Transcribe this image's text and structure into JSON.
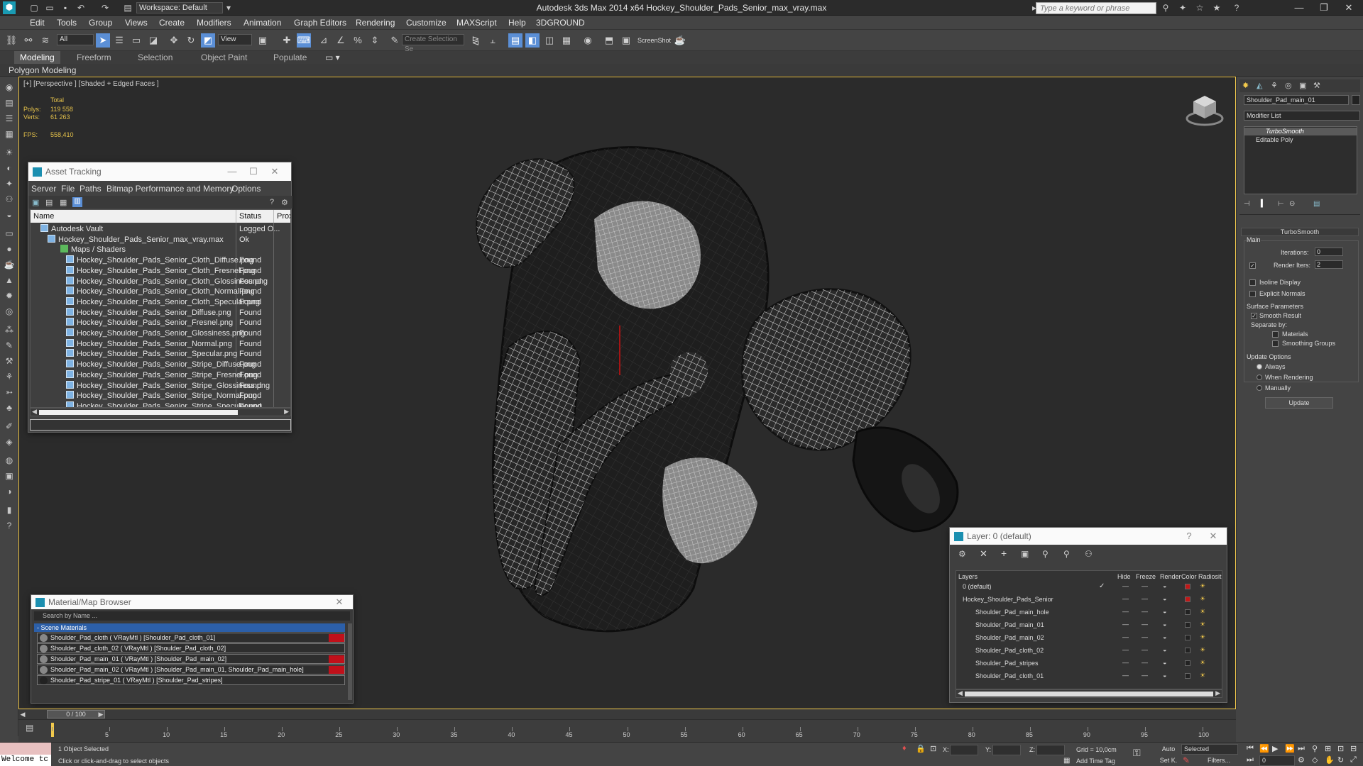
{
  "app": {
    "title": "Autodesk 3ds Max  2014 x64     Hockey_Shoulder_Pads_Senior_max_vray.max",
    "workspace": "Workspace: Default",
    "search_placeholder": "Type a keyword or phrase"
  },
  "menubar": [
    "Edit",
    "Tools",
    "Group",
    "Views",
    "Create",
    "Modifiers",
    "Animation",
    "Graph Editors",
    "Rendering",
    "Customize",
    "MAXScript",
    "Help",
    "3DGROUND"
  ],
  "toolbar": {
    "filter": "All",
    "ref_coord": "View",
    "selection_set": "Create Selection Se",
    "screenshot_label": "ScreenShot"
  },
  "ribbon": {
    "tabs": [
      "Modeling",
      "Freeform",
      "Selection",
      "Object Paint",
      "Populate"
    ],
    "sub_label": "Polygon Modeling"
  },
  "viewport": {
    "label": "[+] [Perspective ] [Shaded + Edged Faces ]",
    "stats": {
      "total_label": "Total",
      "polys_label": "Polys:",
      "polys": "119 558",
      "verts_label": "Verts:",
      "verts": "61 263",
      "fps_label": "FPS:",
      "fps": "558,410"
    }
  },
  "asset_tracking": {
    "title": "Asset Tracking",
    "menu": [
      "Server",
      "File",
      "Paths",
      "Bitmap Performance and Memory",
      "Options"
    ],
    "columns": [
      "Name",
      "Status",
      "Proxy"
    ],
    "rows": [
      {
        "name": "Autodesk Vault",
        "status": "Logged O..."
      },
      {
        "name": "Hockey_Shoulder_Pads_Senior_max_vray.max",
        "status": "Ok"
      },
      {
        "name": "Maps / Shaders",
        "status": ""
      },
      {
        "name": "Hockey_Shoulder_Pads_Senior_Cloth_Diffuse.png",
        "status": "Found"
      },
      {
        "name": "Hockey_Shoulder_Pads_Senior_Cloth_Fresnel.png",
        "status": "Found"
      },
      {
        "name": "Hockey_Shoulder_Pads_Senior_Cloth_Glossiness.png",
        "status": "Found"
      },
      {
        "name": "Hockey_Shoulder_Pads_Senior_Cloth_Normal.png",
        "status": "Found"
      },
      {
        "name": "Hockey_Shoulder_Pads_Senior_Cloth_Specular.png",
        "status": "Found"
      },
      {
        "name": "Hockey_Shoulder_Pads_Senior_Diffuse.png",
        "status": "Found"
      },
      {
        "name": "Hockey_Shoulder_Pads_Senior_Fresnel.png",
        "status": "Found"
      },
      {
        "name": "Hockey_Shoulder_Pads_Senior_Glossiness.png",
        "status": "Found"
      },
      {
        "name": "Hockey_Shoulder_Pads_Senior_Normal.png",
        "status": "Found"
      },
      {
        "name": "Hockey_Shoulder_Pads_Senior_Specular.png",
        "status": "Found"
      },
      {
        "name": "Hockey_Shoulder_Pads_Senior_Stripe_Diffuse.png",
        "status": "Found"
      },
      {
        "name": "Hockey_Shoulder_Pads_Senior_Stripe_Fresnel.png",
        "status": "Found"
      },
      {
        "name": "Hockey_Shoulder_Pads_Senior_Stripe_Glossiness.png",
        "status": "Found"
      },
      {
        "name": "Hockey_Shoulder_Pads_Senior_Stripe_Normal.png",
        "status": "Found"
      },
      {
        "name": "Hockey_Shoulder_Pads_Senior_Stripe_Specular.png",
        "status": "Found"
      }
    ]
  },
  "material_browser": {
    "title": "Material/Map Browser",
    "search_placeholder": "Search by Name ...",
    "group": "- Scene Materials",
    "items": [
      "Shoulder_Pad_cloth ( VRayMtl ) [Shoulder_Pad_cloth_01]",
      "Shoulder_Pad_cloth_02 ( VRayMtl ) [Shoulder_Pad_cloth_02]",
      "Shoulder_Pad_main_01 ( VRayMtl ) [Shoulder_Pad_main_02]",
      "Shoulder_Pad_main_02 ( VRayMtl ) [Shoulder_Pad_main_01, Shoulder_Pad_main_hole]",
      "Shoulder_Pad_stripe_01 ( VRayMtl ) [Shoulder_Pad_stripes]"
    ]
  },
  "layer_dialog": {
    "title": "Layer: 0 (default)",
    "help": "?",
    "columns": [
      "Layers",
      "Hide",
      "Freeze",
      "Render",
      "Color",
      "Radiosit"
    ],
    "rows": [
      {
        "name": "0 (default)",
        "color": "#c01818"
      },
      {
        "name": "Hockey_Shoulder_Pads_Senior",
        "color": "#c01818"
      },
      {
        "name": "Shoulder_Pad_main_hole",
        "color": "#222222"
      },
      {
        "name": "Shoulder_Pad_main_01",
        "color": "#222222"
      },
      {
        "name": "Shoulder_Pad_main_02",
        "color": "#222222"
      },
      {
        "name": "Shoulder_Pad_cloth_02",
        "color": "#222222"
      },
      {
        "name": "Shoulder_Pad_stripes",
        "color": "#222222"
      },
      {
        "name": "Shoulder_Pad_cloth_01",
        "color": "#222222"
      }
    ]
  },
  "command_panel": {
    "object_name": "Shoulder_Pad_main_01",
    "modifier_list": "Modifier List",
    "stack": [
      "TurboSmooth",
      "Editable Poly"
    ],
    "rollout_title": "TurboSmooth",
    "main_label": "Main",
    "iterations_label": "Iterations:",
    "iterations": "0",
    "render_iters_label": "Render Iters:",
    "render_iters": "2",
    "isoline": "Isoline Display",
    "explicit_normals": "Explicit Normals",
    "surface_params": "Surface Parameters",
    "smooth_result": "Smooth Result",
    "separate_by": "Separate by:",
    "materials": "Materials",
    "smoothing_groups": "Smoothing Groups",
    "update_options": "Update Options",
    "always": "Always",
    "when_rendering": "When Rendering",
    "manually": "Manually",
    "update_button": "Update"
  },
  "timeline": {
    "frame": "0 / 100",
    "ticks": [
      "0",
      "5",
      "10",
      "15",
      "20",
      "25",
      "30",
      "35",
      "40",
      "45",
      "50",
      "55",
      "60",
      "65",
      "70",
      "75",
      "80",
      "85",
      "90",
      "95",
      "100"
    ]
  },
  "statusbar": {
    "maxscript": "Welcome tc",
    "selected": "1 Object Selected",
    "prompt": "Click or click-and-drag to select objects",
    "x_label": "X:",
    "y_label": "Y:",
    "z_label": "Z:",
    "grid": "Grid = 10,0cm",
    "auto": "Auto",
    "selected_mode": "Selected",
    "set_k": "Set K.",
    "filters": "Filters...",
    "add_time_tag": "Add Time Tag",
    "frame_field": "0"
  },
  "colors": {
    "viewport_border": "#f2c94c",
    "stat_text": "#e3c04a",
    "accent_blue": "#2c5fa8"
  }
}
